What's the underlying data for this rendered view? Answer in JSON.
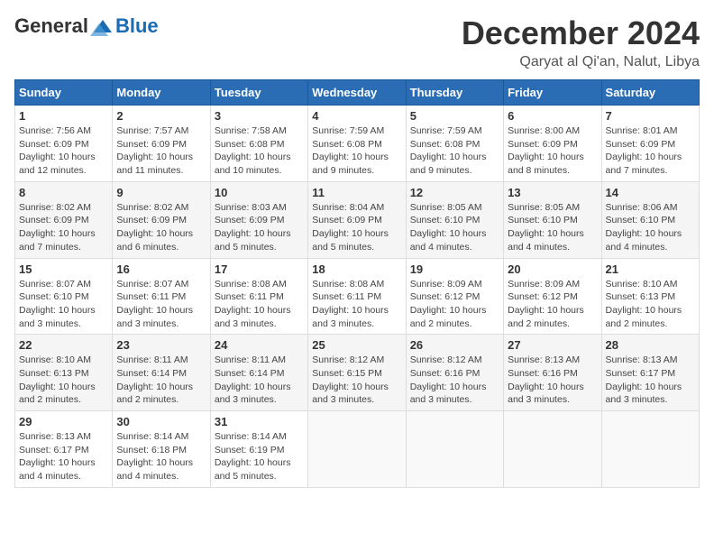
{
  "logo": {
    "general": "General",
    "blue": "Blue"
  },
  "title": "December 2024",
  "subtitle": "Qaryat al Qi'an, Nalut, Libya",
  "days_of_week": [
    "Sunday",
    "Monday",
    "Tuesday",
    "Wednesday",
    "Thursday",
    "Friday",
    "Saturday"
  ],
  "weeks": [
    [
      {
        "num": "1",
        "sunrise": "7:56 AM",
        "sunset": "6:09 PM",
        "daylight": "10 hours and 12 minutes."
      },
      {
        "num": "2",
        "sunrise": "7:57 AM",
        "sunset": "6:09 PM",
        "daylight": "10 hours and 11 minutes."
      },
      {
        "num": "3",
        "sunrise": "7:58 AM",
        "sunset": "6:08 PM",
        "daylight": "10 hours and 10 minutes."
      },
      {
        "num": "4",
        "sunrise": "7:59 AM",
        "sunset": "6:08 PM",
        "daylight": "10 hours and 9 minutes."
      },
      {
        "num": "5",
        "sunrise": "7:59 AM",
        "sunset": "6:08 PM",
        "daylight": "10 hours and 9 minutes."
      },
      {
        "num": "6",
        "sunrise": "8:00 AM",
        "sunset": "6:09 PM",
        "daylight": "10 hours and 8 minutes."
      },
      {
        "num": "7",
        "sunrise": "8:01 AM",
        "sunset": "6:09 PM",
        "daylight": "10 hours and 7 minutes."
      }
    ],
    [
      {
        "num": "8",
        "sunrise": "8:02 AM",
        "sunset": "6:09 PM",
        "daylight": "10 hours and 7 minutes."
      },
      {
        "num": "9",
        "sunrise": "8:02 AM",
        "sunset": "6:09 PM",
        "daylight": "10 hours and 6 minutes."
      },
      {
        "num": "10",
        "sunrise": "8:03 AM",
        "sunset": "6:09 PM",
        "daylight": "10 hours and 5 minutes."
      },
      {
        "num": "11",
        "sunrise": "8:04 AM",
        "sunset": "6:09 PM",
        "daylight": "10 hours and 5 minutes."
      },
      {
        "num": "12",
        "sunrise": "8:05 AM",
        "sunset": "6:10 PM",
        "daylight": "10 hours and 4 minutes."
      },
      {
        "num": "13",
        "sunrise": "8:05 AM",
        "sunset": "6:10 PM",
        "daylight": "10 hours and 4 minutes."
      },
      {
        "num": "14",
        "sunrise": "8:06 AM",
        "sunset": "6:10 PM",
        "daylight": "10 hours and 4 minutes."
      }
    ],
    [
      {
        "num": "15",
        "sunrise": "8:07 AM",
        "sunset": "6:10 PM",
        "daylight": "10 hours and 3 minutes."
      },
      {
        "num": "16",
        "sunrise": "8:07 AM",
        "sunset": "6:11 PM",
        "daylight": "10 hours and 3 minutes."
      },
      {
        "num": "17",
        "sunrise": "8:08 AM",
        "sunset": "6:11 PM",
        "daylight": "10 hours and 3 minutes."
      },
      {
        "num": "18",
        "sunrise": "8:08 AM",
        "sunset": "6:11 PM",
        "daylight": "10 hours and 3 minutes."
      },
      {
        "num": "19",
        "sunrise": "8:09 AM",
        "sunset": "6:12 PM",
        "daylight": "10 hours and 2 minutes."
      },
      {
        "num": "20",
        "sunrise": "8:09 AM",
        "sunset": "6:12 PM",
        "daylight": "10 hours and 2 minutes."
      },
      {
        "num": "21",
        "sunrise": "8:10 AM",
        "sunset": "6:13 PM",
        "daylight": "10 hours and 2 minutes."
      }
    ],
    [
      {
        "num": "22",
        "sunrise": "8:10 AM",
        "sunset": "6:13 PM",
        "daylight": "10 hours and 2 minutes."
      },
      {
        "num": "23",
        "sunrise": "8:11 AM",
        "sunset": "6:14 PM",
        "daylight": "10 hours and 2 minutes."
      },
      {
        "num": "24",
        "sunrise": "8:11 AM",
        "sunset": "6:14 PM",
        "daylight": "10 hours and 3 minutes."
      },
      {
        "num": "25",
        "sunrise": "8:12 AM",
        "sunset": "6:15 PM",
        "daylight": "10 hours and 3 minutes."
      },
      {
        "num": "26",
        "sunrise": "8:12 AM",
        "sunset": "6:16 PM",
        "daylight": "10 hours and 3 minutes."
      },
      {
        "num": "27",
        "sunrise": "8:13 AM",
        "sunset": "6:16 PM",
        "daylight": "10 hours and 3 minutes."
      },
      {
        "num": "28",
        "sunrise": "8:13 AM",
        "sunset": "6:17 PM",
        "daylight": "10 hours and 3 minutes."
      }
    ],
    [
      {
        "num": "29",
        "sunrise": "8:13 AM",
        "sunset": "6:17 PM",
        "daylight": "10 hours and 4 minutes."
      },
      {
        "num": "30",
        "sunrise": "8:14 AM",
        "sunset": "6:18 PM",
        "daylight": "10 hours and 4 minutes."
      },
      {
        "num": "31",
        "sunrise": "8:14 AM",
        "sunset": "6:19 PM",
        "daylight": "10 hours and 5 minutes."
      },
      null,
      null,
      null,
      null
    ]
  ]
}
